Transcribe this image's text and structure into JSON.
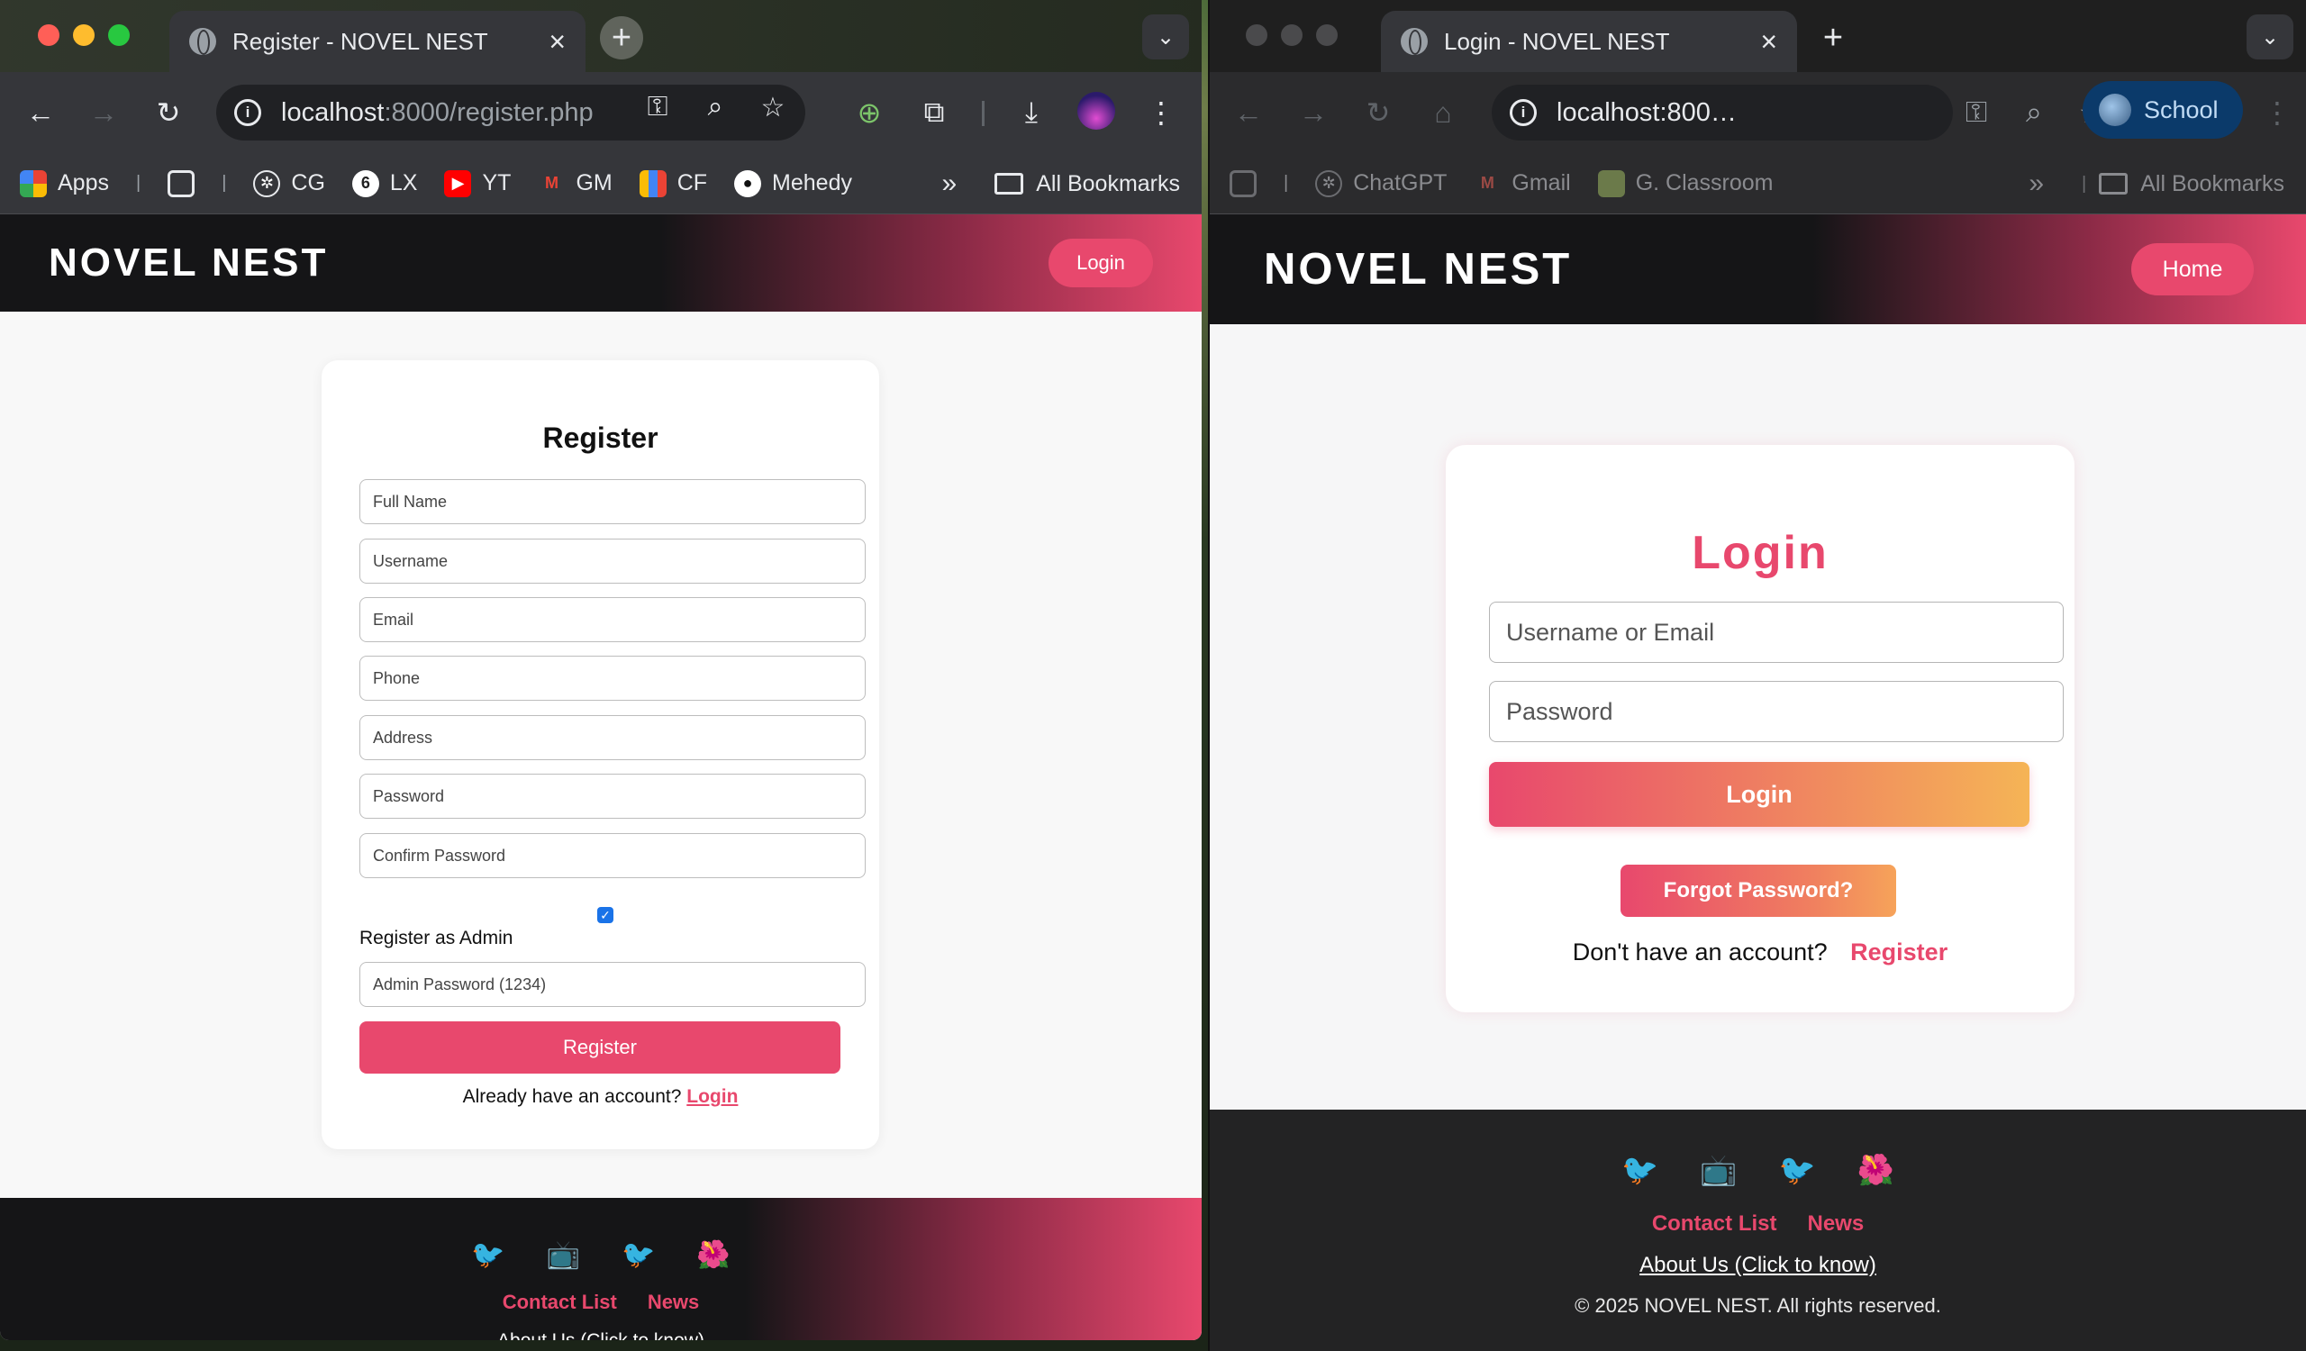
{
  "left": {
    "tab_title": "Register - NOVEL NEST",
    "url_host": "localhost",
    "url_path": ":8000/register.php",
    "bookmarks": [
      "Apps",
      "CG",
      "LX",
      "YT",
      "GM",
      "CF",
      "Mehedy"
    ],
    "all_bookmarks": "All Bookmarks",
    "brand": "NOVEL NEST",
    "header_button": "Login",
    "form_title": "Register",
    "fields": [
      "Full Name",
      "Username",
      "Email",
      "Phone",
      "Address",
      "Password",
      "Confirm Password"
    ],
    "admin_checkbox_label": "Register as Admin",
    "admin_password_placeholder": "Admin Password (1234)",
    "submit": "Register",
    "have_account": "Already have an account?",
    "login_link": "Login",
    "footer_links": [
      "Contact List",
      "News"
    ],
    "about": "About Us (Click to know)"
  },
  "right": {
    "tab_title": "Login - NOVEL NEST",
    "url": "localhost:800…",
    "profile": "School",
    "bookmarks": [
      "ChatGPT",
      "Gmail",
      "G. Classroom"
    ],
    "all_bookmarks": "All Bookmarks",
    "brand": "NOVEL NEST",
    "header_button": "Home",
    "form_title": "Login",
    "username_placeholder": "Username or Email",
    "password_placeholder": "Password",
    "submit": "Login",
    "forgot": "Forgot Password?",
    "no_account": "Don't have an account?",
    "register_link": "Register",
    "footer_links": [
      "Contact List",
      "News"
    ],
    "about": "About Us (Click to know)",
    "copyright": "© 2025 NOVEL NEST. All rights reserved."
  },
  "colors": {
    "accent": "#e8486d",
    "accent_gradient_end": "#f5b456",
    "header_dark": "#151517"
  },
  "social_icons": [
    "bird-icon",
    "tv-icon",
    "bird-icon",
    "flower-icon"
  ]
}
